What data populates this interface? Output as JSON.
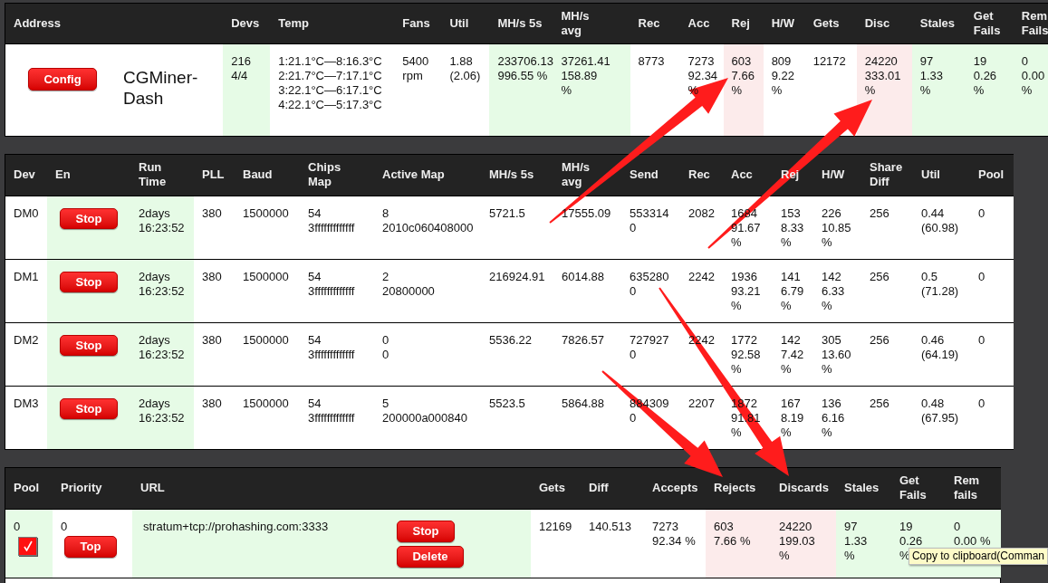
{
  "summary": {
    "columns": [
      {
        "lines": [
          "Address"
        ]
      },
      {
        "lines": [
          "Devs"
        ]
      },
      {
        "lines": [
          "Temp"
        ]
      },
      {
        "lines": [
          "Fans"
        ]
      },
      {
        "lines": [
          "Util"
        ]
      },
      {
        "lines": [
          "MH/s 5s"
        ]
      },
      {
        "lines": [
          "MH/s",
          "avg"
        ]
      },
      {
        "lines": [
          "Rec"
        ]
      },
      {
        "lines": [
          "Acc"
        ]
      },
      {
        "lines": [
          "Rej"
        ]
      },
      {
        "lines": [
          "H/W"
        ]
      },
      {
        "lines": [
          "Gets"
        ]
      },
      {
        "lines": [
          "Disc"
        ]
      },
      {
        "lines": [
          "Stales"
        ]
      },
      {
        "lines": [
          "Get",
          "Fails"
        ]
      },
      {
        "lines": [
          "Rem",
          "Fails"
        ]
      }
    ],
    "rows": [
      {
        "cells": [
          {
            "kind": "address",
            "button": "Config",
            "name": "CGMiner-Dash",
            "color": "#ffffff"
          },
          {
            "kind": "text",
            "lines": [
              "216",
              "4/4"
            ],
            "color": "#e6fbe6"
          },
          {
            "kind": "text",
            "lines": [
              "1:21.1°C—8:16.3°C",
              "2:21.7°C—7:17.1°C",
              "3:22.1°C—6:17.1°C",
              "4:22.1°C—5:17.3°C"
            ],
            "color": "#ffffff"
          },
          {
            "kind": "text",
            "lines": [
              "5400",
              "rpm"
            ],
            "color": "#ffffff"
          },
          {
            "kind": "text",
            "lines": [
              "1.88",
              "(2.06)"
            ],
            "color": "#ffffff"
          },
          {
            "kind": "text",
            "lines": [
              "233706.13",
              "996.55 %"
            ],
            "color": "#e6fbe6"
          },
          {
            "kind": "text",
            "lines": [
              "37261.41",
              "158.89",
              "%"
            ],
            "color": "#e6fbe6"
          },
          {
            "kind": "text",
            "lines": [
              "8773"
            ],
            "color": "#ffffff"
          },
          {
            "kind": "text",
            "lines": [
              "7273",
              "92.34",
              "%"
            ],
            "color": "#ffffff"
          },
          {
            "kind": "text",
            "lines": [
              "603",
              "7.66",
              "%"
            ],
            "color": "#fcebeb"
          },
          {
            "kind": "text",
            "lines": [
              "809",
              "9.22",
              "%"
            ],
            "color": "#ffffff"
          },
          {
            "kind": "text",
            "lines": [
              "12172"
            ],
            "color": "#ffffff"
          },
          {
            "kind": "text",
            "lines": [
              "24220",
              "333.01",
              "%"
            ],
            "color": "#fcebeb"
          },
          {
            "kind": "text",
            "lines": [
              "97",
              "1.33",
              "%"
            ],
            "color": "#e6fbe6"
          },
          {
            "kind": "text",
            "lines": [
              "19",
              "0.26",
              "%"
            ],
            "color": "#e6fbe6"
          },
          {
            "kind": "text",
            "lines": [
              "0",
              "0.00",
              "%"
            ],
            "color": "#e6fbe6"
          }
        ]
      }
    ]
  },
  "devices": {
    "columns": [
      {
        "lines": [
          "Dev"
        ]
      },
      {
        "lines": [
          "En"
        ]
      },
      {
        "lines": [
          "Run",
          "Time"
        ]
      },
      {
        "lines": [
          "PLL"
        ]
      },
      {
        "lines": [
          "Baud"
        ]
      },
      {
        "lines": [
          "Chips",
          "Map"
        ]
      },
      {
        "lines": [
          "Active Map"
        ]
      },
      {
        "lines": [
          "MH/s 5s"
        ]
      },
      {
        "lines": [
          "MH/s",
          "avg"
        ]
      },
      {
        "lines": [
          "Send"
        ]
      },
      {
        "lines": [
          "Rec"
        ]
      },
      {
        "lines": [
          "Acc"
        ]
      },
      {
        "lines": [
          "Rej"
        ]
      },
      {
        "lines": [
          "H/W"
        ]
      },
      {
        "lines": [
          "Share",
          "Diff"
        ]
      },
      {
        "lines": [
          "Util"
        ]
      },
      {
        "lines": [
          "Pool"
        ]
      }
    ],
    "rows": [
      {
        "cells": [
          {
            "kind": "text",
            "lines": [
              "DM0"
            ],
            "color": "#ffffff"
          },
          {
            "kind": "button",
            "label": "Stop",
            "color": "#e6fbe6"
          },
          {
            "kind": "text",
            "lines": [
              "2days",
              "16:23:52"
            ],
            "color": "#e6fbe6"
          },
          {
            "kind": "text",
            "lines": [
              "380"
            ],
            "color": "#ffffff"
          },
          {
            "kind": "text",
            "lines": [
              "1500000"
            ],
            "color": "#ffffff"
          },
          {
            "kind": "text",
            "lines": [
              "54",
              "3fffffffffffff"
            ],
            "color": "#ffffff"
          },
          {
            "kind": "text",
            "lines": [
              "8",
              "2010c060408000"
            ],
            "color": "#ffffff"
          },
          {
            "kind": "text",
            "lines": [
              "5721.5"
            ],
            "color": "#ffffff"
          },
          {
            "kind": "text",
            "lines": [
              "17555.09"
            ],
            "color": "#ffffff"
          },
          {
            "kind": "text",
            "lines": [
              "553314",
              "0"
            ],
            "color": "#ffffff"
          },
          {
            "kind": "text",
            "lines": [
              "2082"
            ],
            "color": "#ffffff"
          },
          {
            "kind": "text",
            "lines": [
              "1684",
              "91.67",
              "%"
            ],
            "color": "#ffffff"
          },
          {
            "kind": "text",
            "lines": [
              "153",
              "8.33",
              "%"
            ],
            "color": "#ffffff"
          },
          {
            "kind": "text",
            "lines": [
              "226",
              "10.85",
              "%"
            ],
            "color": "#ffffff"
          },
          {
            "kind": "text",
            "lines": [
              "256"
            ],
            "color": "#ffffff"
          },
          {
            "kind": "text",
            "lines": [
              "0.44",
              "(60.98)"
            ],
            "color": "#ffffff"
          },
          {
            "kind": "text",
            "lines": [
              "0"
            ],
            "color": "#ffffff"
          }
        ]
      },
      {
        "cells": [
          {
            "kind": "text",
            "lines": [
              "DM1"
            ],
            "color": "#ffffff"
          },
          {
            "kind": "button",
            "label": "Stop",
            "color": "#e6fbe6"
          },
          {
            "kind": "text",
            "lines": [
              "2days",
              "16:23:52"
            ],
            "color": "#e6fbe6"
          },
          {
            "kind": "text",
            "lines": [
              "380"
            ],
            "color": "#ffffff"
          },
          {
            "kind": "text",
            "lines": [
              "1500000"
            ],
            "color": "#ffffff"
          },
          {
            "kind": "text",
            "lines": [
              "54",
              "3fffffffffffff"
            ],
            "color": "#ffffff"
          },
          {
            "kind": "text",
            "lines": [
              "2",
              "20800000"
            ],
            "color": "#ffffff"
          },
          {
            "kind": "text",
            "lines": [
              "216924.91"
            ],
            "color": "#ffffff"
          },
          {
            "kind": "text",
            "lines": [
              "6014.88"
            ],
            "color": "#ffffff"
          },
          {
            "kind": "text",
            "lines": [
              "635280",
              "0"
            ],
            "color": "#ffffff"
          },
          {
            "kind": "text",
            "lines": [
              "2242"
            ],
            "color": "#ffffff"
          },
          {
            "kind": "text",
            "lines": [
              "1936",
              "93.21",
              "%"
            ],
            "color": "#ffffff"
          },
          {
            "kind": "text",
            "lines": [
              "141",
              "6.79",
              "%"
            ],
            "color": "#ffffff"
          },
          {
            "kind": "text",
            "lines": [
              "142",
              "6.33",
              "%"
            ],
            "color": "#ffffff"
          },
          {
            "kind": "text",
            "lines": [
              "256"
            ],
            "color": "#ffffff"
          },
          {
            "kind": "text",
            "lines": [
              "0.5",
              "(71.28)"
            ],
            "color": "#ffffff"
          },
          {
            "kind": "text",
            "lines": [
              "0"
            ],
            "color": "#ffffff"
          }
        ]
      },
      {
        "cells": [
          {
            "kind": "text",
            "lines": [
              "DM2"
            ],
            "color": "#ffffff"
          },
          {
            "kind": "button",
            "label": "Stop",
            "color": "#e6fbe6"
          },
          {
            "kind": "text",
            "lines": [
              "2days",
              "16:23:52"
            ],
            "color": "#e6fbe6"
          },
          {
            "kind": "text",
            "lines": [
              "380"
            ],
            "color": "#ffffff"
          },
          {
            "kind": "text",
            "lines": [
              "1500000"
            ],
            "color": "#ffffff"
          },
          {
            "kind": "text",
            "lines": [
              "54",
              "3fffffffffffff"
            ],
            "color": "#ffffff"
          },
          {
            "kind": "text",
            "lines": [
              "0",
              "0"
            ],
            "color": "#ffffff"
          },
          {
            "kind": "text",
            "lines": [
              "5536.22"
            ],
            "color": "#ffffff"
          },
          {
            "kind": "text",
            "lines": [
              "7826.57"
            ],
            "color": "#ffffff"
          },
          {
            "kind": "text",
            "lines": [
              "727927",
              "0"
            ],
            "color": "#ffffff"
          },
          {
            "kind": "text",
            "lines": [
              "2242"
            ],
            "color": "#ffffff"
          },
          {
            "kind": "text",
            "lines": [
              "1772",
              "92.58",
              "%"
            ],
            "color": "#ffffff"
          },
          {
            "kind": "text",
            "lines": [
              "142",
              "7.42",
              "%"
            ],
            "color": "#ffffff"
          },
          {
            "kind": "text",
            "lines": [
              "305",
              "13.60",
              "%"
            ],
            "color": "#ffffff"
          },
          {
            "kind": "text",
            "lines": [
              "256"
            ],
            "color": "#ffffff"
          },
          {
            "kind": "text",
            "lines": [
              "0.46",
              "(64.19)"
            ],
            "color": "#ffffff"
          },
          {
            "kind": "text",
            "lines": [
              "0"
            ],
            "color": "#ffffff"
          }
        ]
      },
      {
        "cells": [
          {
            "kind": "text",
            "lines": [
              "DM3"
            ],
            "color": "#ffffff"
          },
          {
            "kind": "button",
            "label": "Stop",
            "color": "#e6fbe6"
          },
          {
            "kind": "text",
            "lines": [
              "2days",
              "16:23:52"
            ],
            "color": "#e6fbe6"
          },
          {
            "kind": "text",
            "lines": [
              "380"
            ],
            "color": "#ffffff"
          },
          {
            "kind": "text",
            "lines": [
              "1500000"
            ],
            "color": "#ffffff"
          },
          {
            "kind": "text",
            "lines": [
              "54",
              "3fffffffffffff"
            ],
            "color": "#ffffff"
          },
          {
            "kind": "text",
            "lines": [
              "5",
              "200000a000840"
            ],
            "color": "#ffffff"
          },
          {
            "kind": "text",
            "lines": [
              "5523.5"
            ],
            "color": "#ffffff"
          },
          {
            "kind": "text",
            "lines": [
              "5864.88"
            ],
            "color": "#ffffff"
          },
          {
            "kind": "text",
            "lines": [
              "884309",
              "0"
            ],
            "color": "#ffffff"
          },
          {
            "kind": "text",
            "lines": [
              "2207"
            ],
            "color": "#ffffff"
          },
          {
            "kind": "text",
            "lines": [
              "1872",
              "91.81",
              "%"
            ],
            "color": "#ffffff"
          },
          {
            "kind": "text",
            "lines": [
              "167",
              "8.19",
              "%"
            ],
            "color": "#ffffff"
          },
          {
            "kind": "text",
            "lines": [
              "136",
              "6.16",
              "%"
            ],
            "color": "#ffffff"
          },
          {
            "kind": "text",
            "lines": [
              "256"
            ],
            "color": "#ffffff"
          },
          {
            "kind": "text",
            "lines": [
              "0.48",
              "(67.95)"
            ],
            "color": "#ffffff"
          },
          {
            "kind": "text",
            "lines": [
              "0"
            ],
            "color": "#ffffff"
          }
        ]
      }
    ]
  },
  "pools": {
    "columns": [
      {
        "lines": [
          "Pool"
        ]
      },
      {
        "lines": [
          "Priority"
        ]
      },
      {
        "lines": [
          "URL"
        ]
      },
      {
        "lines": [
          "Gets"
        ]
      },
      {
        "lines": [
          "Diff"
        ]
      },
      {
        "lines": [
          "Accepts"
        ]
      },
      {
        "lines": [
          "Rejects"
        ]
      },
      {
        "lines": [
          "Discards"
        ]
      },
      {
        "lines": [
          "Stales"
        ]
      },
      {
        "lines": [
          "Get",
          "Fails"
        ]
      },
      {
        "lines": [
          "Rem",
          "fails"
        ]
      }
    ],
    "rows": [
      {
        "cells": [
          {
            "kind": "pool",
            "value": "0",
            "checked": true,
            "color": "#e6fbe6"
          },
          {
            "kind": "priority",
            "value": "0",
            "button": "Top",
            "color": "#ffffff"
          },
          {
            "kind": "url",
            "value": "stratum+tcp://prohashing.com:3333",
            "buttons": [
              "Stop",
              "Delete"
            ],
            "color": "#e6fbe6"
          },
          {
            "kind": "text",
            "lines": [
              "12169"
            ],
            "color": "#ffffff"
          },
          {
            "kind": "text",
            "lines": [
              "140.513"
            ],
            "color": "#ffffff"
          },
          {
            "kind": "text",
            "lines": [
              "7273",
              "92.34 %"
            ],
            "color": "#ffffff"
          },
          {
            "kind": "text",
            "lines": [
              "603",
              "7.66 %"
            ],
            "color": "#fcebeb"
          },
          {
            "kind": "text",
            "lines": [
              "24220",
              "199.03",
              "%"
            ],
            "color": "#fcebeb"
          },
          {
            "kind": "text",
            "lines": [
              "97",
              "1.33",
              "%"
            ],
            "color": "#e6fbe6"
          },
          {
            "kind": "text",
            "lines": [
              "19",
              "0.26",
              "%"
            ],
            "color": "#e6fbe6"
          },
          {
            "kind": "text",
            "lines": [
              "0",
              "0.00 %"
            ],
            "color": "#e6fbe6"
          }
        ]
      }
    ]
  },
  "tooltip": {
    "text": "Copy to clipboard(Comman"
  }
}
